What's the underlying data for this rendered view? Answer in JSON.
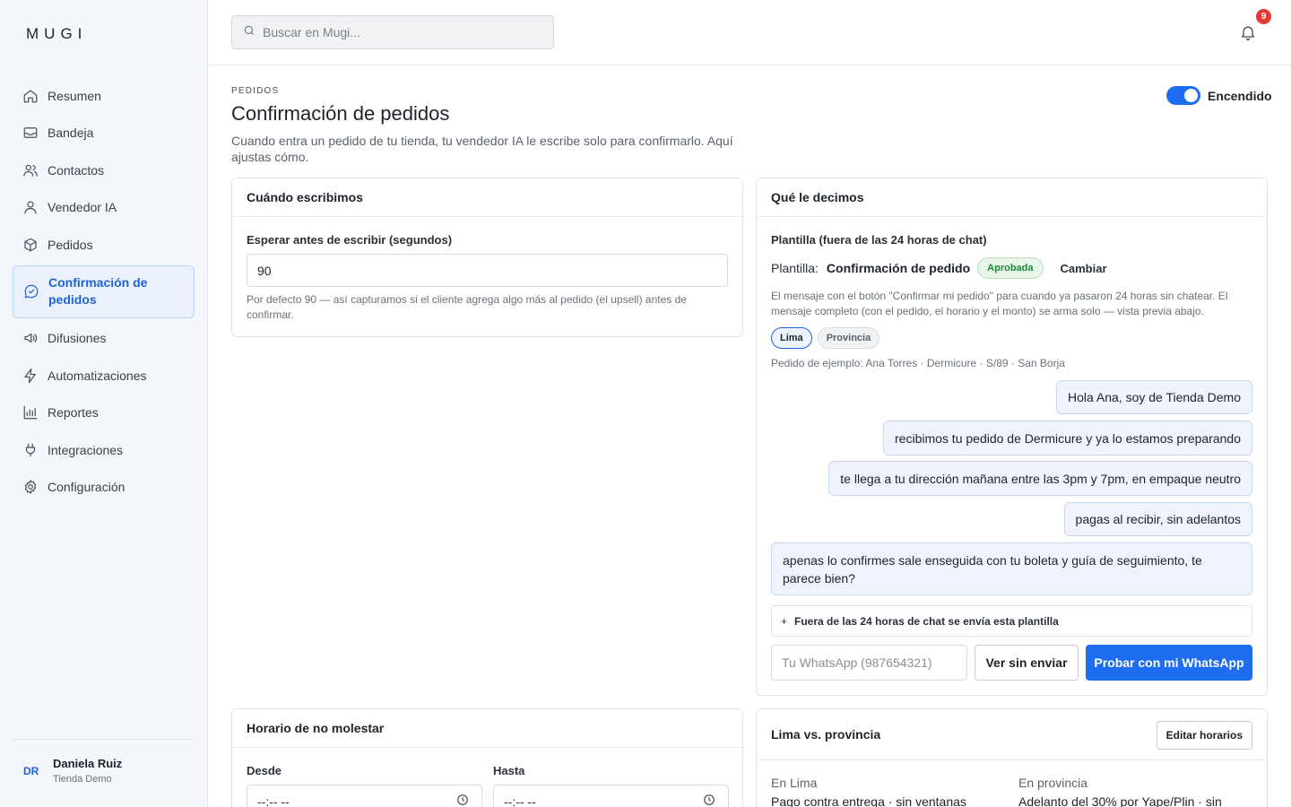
{
  "brand": "MUGI",
  "search": {
    "placeholder": "Buscar en Mugi..."
  },
  "notifications": {
    "count": "9"
  },
  "sidebar": {
    "items": [
      {
        "label": "Resumen",
        "icon": "home-icon"
      },
      {
        "label": "Bandeja",
        "icon": "inbox-icon"
      },
      {
        "label": "Contactos",
        "icon": "users-icon"
      },
      {
        "label": "Vendedor IA",
        "icon": "user-icon"
      },
      {
        "label": "Pedidos",
        "icon": "box-icon"
      },
      {
        "label": "Confirmación de pedidos",
        "icon": "chat-check-icon",
        "active": true
      },
      {
        "label": "Difusiones",
        "icon": "megaphone-icon"
      },
      {
        "label": "Automatizaciones",
        "icon": "bolt-icon"
      },
      {
        "label": "Reportes",
        "icon": "bar-chart-icon"
      },
      {
        "label": "Integraciones",
        "icon": "plug-icon"
      },
      {
        "label": "Configuración",
        "icon": "gear-icon"
      }
    ],
    "user": {
      "initials": "DR",
      "name": "Daniela Ruiz",
      "store": "Tienda Demo"
    }
  },
  "header": {
    "crumb": "PEDIDOS",
    "title": "Confirmación de pedidos",
    "description": "Cuando entra un pedido de tu tienda, tu vendedor IA le escribe solo para confirmarlo. Aquí ajustas cómo.",
    "toggle_label": "Encendido",
    "toggle_on": true
  },
  "when": {
    "title": "Cuándo escribimos",
    "field_label": "Esperar antes de escribir (segundos)",
    "value": "90",
    "hint": "Por defecto 90 — así capturamos si el cliente agrega algo más al pedido (el upsell) antes de confirmar."
  },
  "what": {
    "title": "Qué le decimos",
    "template_title": "Plantilla (fuera de las 24 horas de chat)",
    "template_key": "Plantilla:",
    "template_name": "Confirmación de pedido",
    "template_status": "Aprobada",
    "change_label": "Cambiar",
    "template_desc": "El mensaje con el botón \"Confirmar mi pedido\" para cuando ya pasaron 24 horas sin chatear. El mensaje completo (con el pedido, el horario y el monto) se arma solo — vista previa abajo.",
    "segments": [
      "Lima",
      "Provincia"
    ],
    "example": "Pedido de ejemplo: Ana Torres · Dermicure · S/89 · San Borja",
    "messages": [
      "Hola Ana, soy de Tienda Demo",
      "recibimos tu pedido de Dermicure y ya lo estamos preparando",
      "te llega a tu dirección mañana entre las 3pm y 7pm, en empaque neutro",
      "pagas al recibir, sin adelantos",
      "apenas lo confirmes sale enseguida con tu boleta y guía de seguimiento, te parece bien?"
    ],
    "accordion": "Fuera de las 24 horas de chat se envía esta plantilla",
    "phone_placeholder": "Tu WhatsApp (987654321)",
    "preview_btn": "Ver sin enviar",
    "test_btn": "Probar con mi WhatsApp"
  },
  "dnd": {
    "title": "Horario de no molestar",
    "from_label": "Desde",
    "to_label": "Hasta",
    "from_value": "--:-- --",
    "to_value": "--:-- --"
  },
  "regions": {
    "title": "Lima vs. provincia",
    "edit_btn": "Editar horarios",
    "lima_label": "En Lima",
    "lima_text": "Pago contra entrega · sin ventanas",
    "prov_label": "En provincia",
    "prov_text": "Adelanto del 30% por Yape/Plin · sin"
  },
  "colors": {
    "accent": "#1f6ef0",
    "active_nav": "#1f63d8",
    "badge": "#e53935",
    "approved": "#1e8a3c"
  }
}
